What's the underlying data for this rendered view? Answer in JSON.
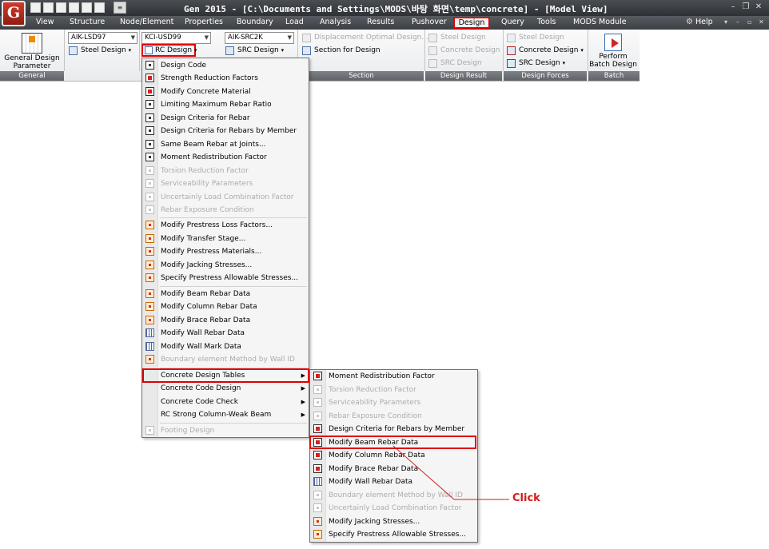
{
  "titlebar": {
    "logo": "G",
    "title": "Gen 2015 - [C:\\Documents and Settings\\MODS\\바탕 화면\\temp\\concrete] - [Model View]",
    "qa_dropdown": "≡"
  },
  "menubar": {
    "items": [
      "View",
      "Structure",
      "Node/Element",
      "Properties",
      "Boundary",
      "Load",
      "Analysis",
      "Results",
      "Pushover",
      "Design",
      "Query",
      "Tools",
      "MODS Module"
    ],
    "help": "Help"
  },
  "ribbon": {
    "general": {
      "label": "General Design Parameter",
      "footer": "General"
    },
    "combo_steel": "AIK-LSD97",
    "steel_design": "Steel Design",
    "combo_rc": "KCI-USD99",
    "rc_design": "RC Design",
    "combo_src": "AIK-SRC2K",
    "src_design": "SRC Design",
    "displacement_optimal": "Displacement Optimal Design...",
    "section_for_design": "Section for Design",
    "section_footer": "Section",
    "result_steel": "Steel Design",
    "result_concrete": "Concrete Design",
    "result_src": "SRC Design",
    "result_footer": "Design Result",
    "forces_steel": "Steel Design",
    "forces_concrete": "Concrete Design",
    "forces_src": "SRC Design",
    "forces_footer": "Design Forces",
    "batch": {
      "label": "Perform Batch Design",
      "footer": "Batch"
    }
  },
  "rc_menu": [
    {
      "label": "Design Code",
      "enabled": true
    },
    {
      "label": "Strength Reduction Factors",
      "enabled": true
    },
    {
      "label": "Modify Concrete Material",
      "enabled": true
    },
    {
      "label": "Limiting Maximum Rebar Ratio",
      "enabled": true
    },
    {
      "label": "Design Criteria for Rebar",
      "enabled": true
    },
    {
      "label": "Design Criteria for Rebars by Member",
      "enabled": true
    },
    {
      "label": "Same Beam Rebar at Joints...",
      "enabled": true
    },
    {
      "label": "Moment Redistribution Factor",
      "enabled": true
    },
    {
      "label": "Torsion Reduction Factor",
      "enabled": false
    },
    {
      "label": "Serviceability Parameters",
      "enabled": false
    },
    {
      "label": "Uncertainly Load Combination Factor",
      "enabled": false
    },
    {
      "label": "Rebar Exposure Condition",
      "enabled": false
    },
    {
      "label": "Modify Prestress Loss Factors...",
      "enabled": true
    },
    {
      "label": "Modify Transfer Stage...",
      "enabled": true
    },
    {
      "label": "Modify Prestress Materials...",
      "enabled": true
    },
    {
      "label": "Modify Jacking Stresses...",
      "enabled": true
    },
    {
      "label": "Specify Prestress Allowable Stresses...",
      "enabled": true
    },
    {
      "label": "Modify Beam Rebar Data",
      "enabled": true
    },
    {
      "label": "Modify Column Rebar Data",
      "enabled": true
    },
    {
      "label": "Modify Brace Rebar Data",
      "enabled": true
    },
    {
      "label": "Modify Wall Rebar Data",
      "enabled": true
    },
    {
      "label": "Modify Wall Mark Data",
      "enabled": true
    },
    {
      "label": "Boundary element Method by Wall ID",
      "enabled": false
    },
    {
      "label": "Concrete Design Tables",
      "enabled": true
    },
    {
      "label": "Concrete Code Design",
      "enabled": true
    },
    {
      "label": "Concrete Code Check",
      "enabled": true
    },
    {
      "label": "RC Strong Column-Weak Beam",
      "enabled": true
    },
    {
      "label": "Footing Design",
      "enabled": false
    }
  ],
  "tables_submenu": [
    {
      "label": "Moment Redistribution Factor",
      "enabled": true
    },
    {
      "label": "Torsion Reduction Factor",
      "enabled": false
    },
    {
      "label": "Serviceability Parameters",
      "enabled": false
    },
    {
      "label": "Rebar Exposure Condition",
      "enabled": false
    },
    {
      "label": "Design Criteria for Rebars by Member",
      "enabled": true
    },
    {
      "label": "Modify Beam Rebar Data",
      "enabled": true
    },
    {
      "label": "Modify Column Rebar Data",
      "enabled": true
    },
    {
      "label": "Modify Brace Rebar Data",
      "enabled": true
    },
    {
      "label": "Modify Wall Rebar Data",
      "enabled": true
    },
    {
      "label": "Boundary element Method by Wall ID",
      "enabled": false
    },
    {
      "label": "Uncertainly Load Combination Factor",
      "enabled": false
    },
    {
      "label": "Modify Jacking Stresses...",
      "enabled": true
    },
    {
      "label": "Specify Prestress Allowable Stresses...",
      "enabled": true
    }
  ],
  "annotation": {
    "click_label": "Click"
  },
  "colors": {
    "highlight": "#e00000",
    "annotation": "#d21a1a"
  }
}
